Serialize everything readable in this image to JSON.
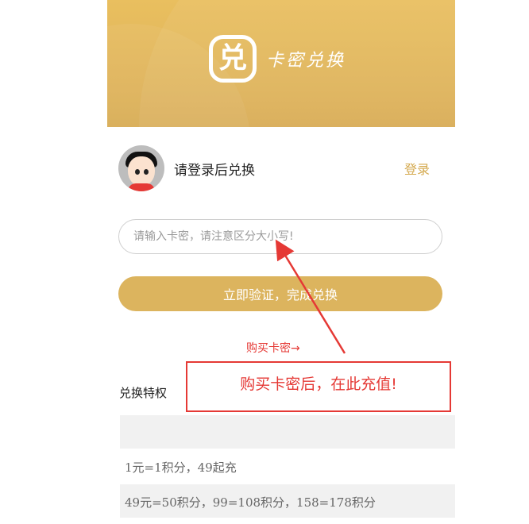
{
  "banner": {
    "logo_char": "兑",
    "title": "卡密兑换"
  },
  "user": {
    "login_prompt": "请登录后兑换",
    "login_link": "登录"
  },
  "card_input": {
    "placeholder": "请输入卡密，请注意区分大小写!",
    "value": ""
  },
  "redeem_button": {
    "label": "立即验证，完成兑换"
  },
  "buy_link": {
    "label": "购买卡密→"
  },
  "privileges": {
    "title": "兑换特权",
    "rows": [
      "",
      "1元=1积分，49起充",
      "49元=50积分，99=108积分，158=178积分"
    ]
  },
  "annotation": {
    "text": "购买卡密后，在此充值!",
    "color": "#e53935"
  },
  "colors": {
    "brand_gold": "#dcb45e",
    "accent_red": "#e53935"
  }
}
